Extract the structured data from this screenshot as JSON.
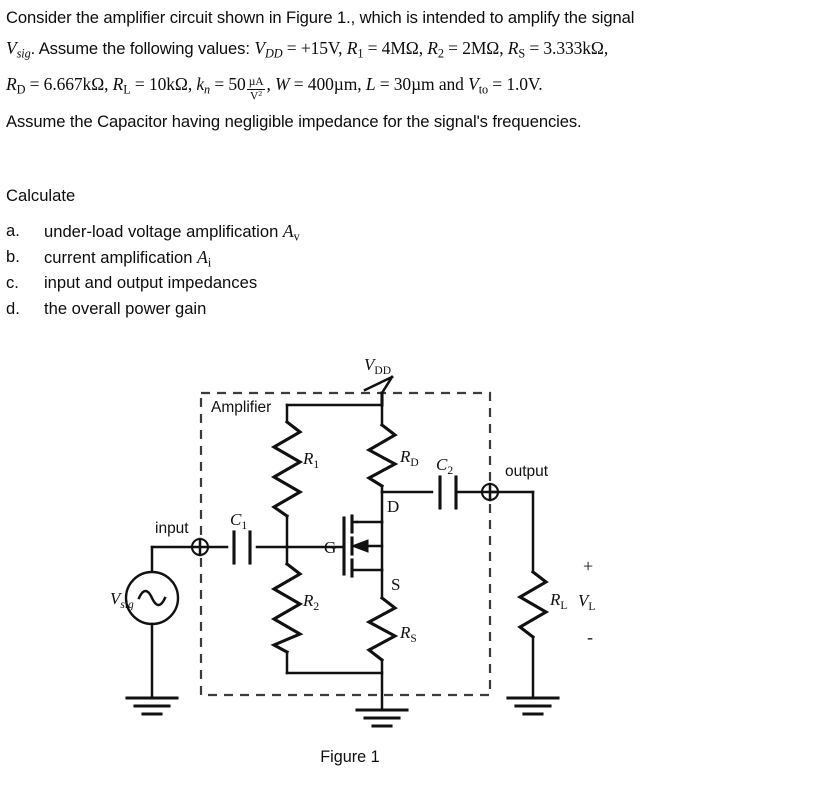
{
  "document": {
    "type": "electronics-homework-problem",
    "statement_lines": [
      "Consider the amplifier circuit shown in Figure 1., which is intended to amplify the signal",
      "Vsig. Assume the following values: VDD = +15V, R1 = 4MΩ, R2 = 2MΩ, RS = 3.333kΩ,",
      "RD = 6.667kΩ, RL = 10kΩ, kn = 50 µA/V², W = 400µm, L = 30µm and Vto = 1.0V.",
      "Assume the Capacitor having negligible impedance for the signal's frequencies."
    ],
    "line1": {
      "text": "Consider the amplifier circuit shown in Figure 1., which is intended to amplify the signal"
    },
    "line2": {
      "seg_a": "V",
      "seg_a_sub": "sig",
      "seg_b": ". Assume the following values: ",
      "vdd": "V",
      "vdd_sub": "DD",
      "vdd_val": " = +15V, ",
      "r1": "R",
      "r1_sub": "1",
      "r1_val": " = 4MΩ, ",
      "r2": "R",
      "r2_sub": "2",
      "r2_val": " = 2MΩ, ",
      "rs": "R",
      "rs_sub": "S",
      "rs_val": " = 3.333kΩ,"
    },
    "line3": {
      "rd": "R",
      "rd_sub": "D",
      "rd_val": " = 6.667kΩ,  ",
      "rl": "R",
      "rl_sub": "L",
      "rl_val": " = 10kΩ,  ",
      "kn": "k",
      "kn_sub": "n",
      "kn_val": " = 50",
      "frac_num": "µA",
      "frac_den": "V",
      "frac_den_sup": "2",
      "comma": ",  ",
      "w": "W",
      "w_val": " = 400µm,  ",
      "l": "L",
      "l_val": " = 30µm  and  ",
      "vto": "V",
      "vto_sub": "to",
      "vto_val": " = 1.0V."
    },
    "line4": {
      "text": "Assume the Capacitor having negligible impedance for the signal's frequencies."
    },
    "calculate_heading": "Calculate",
    "questions": [
      {
        "marker": "a.",
        "text_pre": "under-load voltage amplification ",
        "symbol": "A",
        "symbol_sub": "v"
      },
      {
        "marker": "b.",
        "text_pre": "current amplification ",
        "symbol": "A",
        "symbol_sub": "i"
      },
      {
        "marker": "c.",
        "text_pre": "input and output impedances",
        "symbol": "",
        "symbol_sub": ""
      },
      {
        "marker": "d.",
        "text_pre": "the overall power gain",
        "symbol": "",
        "symbol_sub": ""
      }
    ]
  },
  "figure": {
    "caption": "Figure 1",
    "amplifier_box_label": "Amplifier",
    "labels": {
      "vdd": "V",
      "vdd_sub": "DD",
      "r1": "R",
      "r1_sub": "1",
      "r2": "R",
      "r2_sub": "2",
      "rd": "R",
      "rd_sub": "D",
      "rs": "R",
      "rs_sub": "S",
      "rl": "R",
      "rl_sub": "L",
      "c1": "C",
      "c1_sub": "1",
      "c2": "C",
      "c2_sub": "2",
      "vsig": "V",
      "vsig_sub": "sig",
      "vl": "V",
      "vl_sub": "L",
      "gate": "G",
      "drain": "D",
      "source": "S",
      "input": "input",
      "output": "output",
      "plus": "+",
      "minus": "-"
    },
    "components": [
      {
        "name": "R1",
        "type": "resistor",
        "note": "upper bias divider resistor"
      },
      {
        "name": "R2",
        "type": "resistor",
        "note": "lower bias divider resistor"
      },
      {
        "name": "RD",
        "type": "resistor",
        "note": "drain resistor"
      },
      {
        "name": "RS",
        "type": "resistor",
        "note": "source resistor"
      },
      {
        "name": "RL",
        "type": "resistor",
        "note": "load resistor"
      },
      {
        "name": "C1",
        "type": "capacitor",
        "note": "input coupling capacitor"
      },
      {
        "name": "C2",
        "type": "capacitor",
        "note": "output coupling capacitor"
      },
      {
        "name": "M1",
        "type": "nmos-transistor",
        "note": "n-channel MOSFET"
      },
      {
        "name": "Vsig",
        "type": "ac-voltage-source",
        "note": "signal source"
      }
    ]
  },
  "colors": {
    "ink": "#111111",
    "dashed": "#3b3b3b",
    "paper": "#ffffff"
  }
}
